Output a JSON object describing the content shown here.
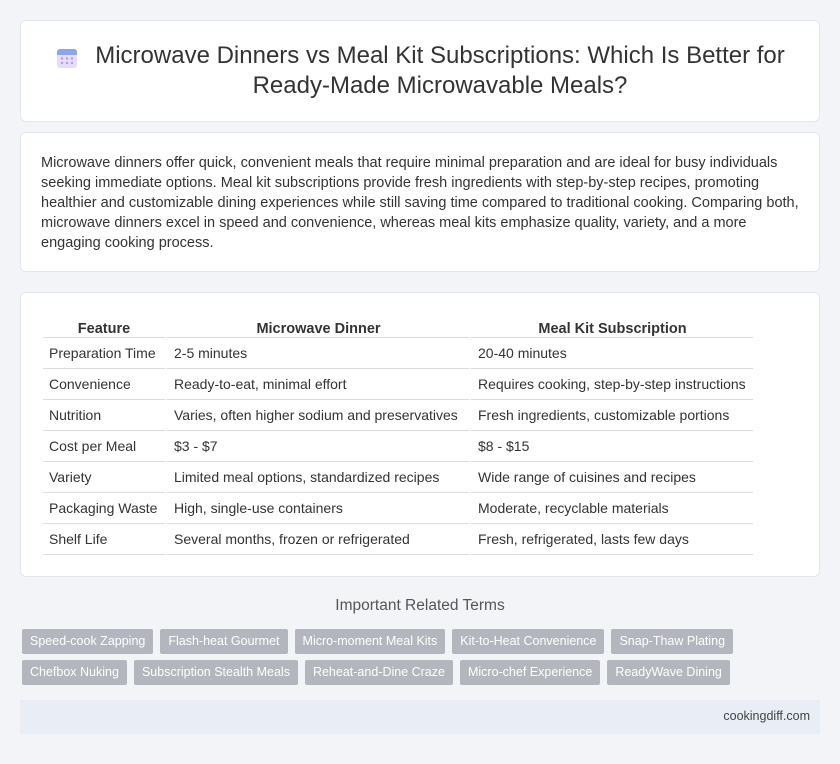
{
  "header": {
    "title": "Microwave Dinners vs Meal Kit Subscriptions: Which Is Better for Ready-Made Microwavable Meals?",
    "icon": "calendar-icon"
  },
  "summary": {
    "text": "Microwave dinners offer quick, convenient meals that require minimal preparation and are ideal for busy individuals seeking immediate options. Meal kit subscriptions provide fresh ingredients with step-by-step recipes, promoting healthier and customizable dining experiences while still saving time compared to traditional cooking. Comparing both, microwave dinners excel in speed and convenience, whereas meal kits emphasize quality, variety, and a more engaging cooking process."
  },
  "table": {
    "headers": [
      "Feature",
      "Microwave Dinner",
      "Meal Kit Subscription"
    ],
    "rows": [
      [
        "Preparation Time",
        "2-5 minutes",
        "20-40 minutes"
      ],
      [
        "Convenience",
        "Ready-to-eat, minimal effort",
        "Requires cooking, step-by-step instructions"
      ],
      [
        "Nutrition",
        "Varies, often higher sodium and preservatives",
        "Fresh ingredients, customizable portions"
      ],
      [
        "Cost per Meal",
        "$3 - $7",
        "$8 - $15"
      ],
      [
        "Variety",
        "Limited meal options, standardized recipes",
        "Wide range of cuisines and recipes"
      ],
      [
        "Packaging Waste",
        "High, single-use containers",
        "Moderate, recyclable materials"
      ],
      [
        "Shelf Life",
        "Several months, frozen or refrigerated",
        "Fresh, refrigerated, lasts few days"
      ]
    ]
  },
  "related": {
    "title": "Important Related Terms",
    "tags": [
      "Speed-cook Zapping",
      "Flash-heat Gourmet",
      "Micro-moment Meal Kits",
      "Kit-to-Heat Convenience",
      "Snap-Thaw Plating",
      "Chefbox Nuking",
      "Subscription Stealth Meals",
      "Reheat-and-Dine Craze",
      "Micro-chef Experience",
      "ReadyWave Dining"
    ]
  },
  "footer": {
    "site": "cookingdiff.com"
  },
  "colors": {
    "background": "#f3f4f7",
    "tag": "#b3b6bd",
    "footer": "#e8edf6",
    "icon_top": "#8ea6e8",
    "icon_body": "#c8b4f0"
  }
}
